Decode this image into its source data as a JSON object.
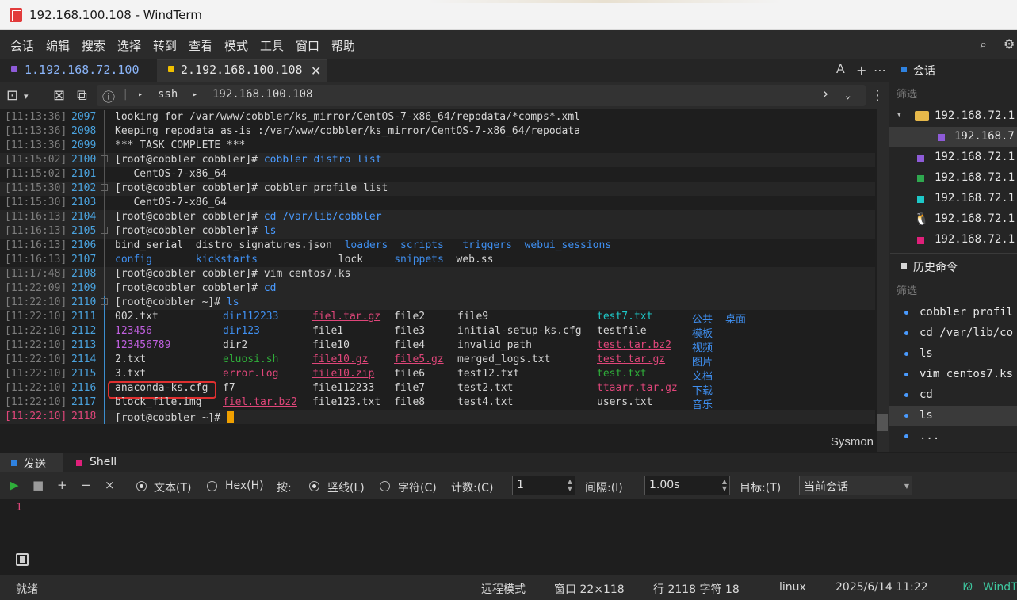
{
  "window": {
    "title": "192.168.100.108 - WindTerm"
  },
  "menu": [
    "会话",
    "编辑",
    "搜索",
    "选择",
    "转到",
    "查看",
    "模式",
    "工具",
    "窗口",
    "帮助"
  ],
  "menu_right_icons": [
    "search-icon",
    "settings-icon"
  ],
  "tabs": [
    {
      "label": "1.192.168.72.100",
      "color": "#8e5bd8",
      "active": false
    },
    {
      "label": "2.192.168.100.108",
      "color": "#f0c000",
      "active": true,
      "close": "✕"
    }
  ],
  "tab_right": {
    "font": "A",
    "add": "+",
    "more": "⋯"
  },
  "address": {
    "info_icon": "ⓘ",
    "proto": "ssh",
    "host": "192.168.100.108"
  },
  "terminal": {
    "lines": [
      {
        "ts": "[11:13:36]",
        "n": "2097",
        "segs": [
          {
            "t": "looking for /var/www/cobbler/ks_mirror/CentOS-7-x86_64/repodata/",
            "c": "white"
          },
          {
            "t": "*",
            "c": "white"
          },
          {
            "t": "comps",
            "c": "white"
          },
          {
            "t": "*",
            "c": "white"
          },
          {
            "t": ".xml",
            "c": "white"
          }
        ]
      },
      {
        "ts": "[11:13:36]",
        "n": "2098",
        "segs": [
          {
            "t": "Keeping repodata as-is :/var/www/cobbler/ks_mirror/CentOS-7-x86_64/repodata",
            "c": "white"
          }
        ]
      },
      {
        "ts": "[11:13:36]",
        "n": "2099",
        "segs": [
          {
            "t": "*** TASK COMPLETE ***",
            "c": "white"
          }
        ]
      },
      {
        "ts": "[11:15:02]",
        "n": "2100",
        "prompt": true,
        "segs": [
          {
            "t": "[root@cobbler cobbler]# ",
            "c": "white"
          },
          {
            "t": "cobbler distro list",
            "c": "blue2"
          }
        ]
      },
      {
        "ts": "[11:15:02]",
        "n": "2101",
        "segs": [
          {
            "t": "   CentOS-7-x86_64",
            "c": "white"
          }
        ]
      },
      {
        "ts": "[11:15:30]",
        "n": "2102",
        "prompt": true,
        "segs": [
          {
            "t": "[root@cobbler cobbler]# ",
            "c": "white"
          },
          {
            "t": "cobbler profile list",
            "c": "white"
          }
        ]
      },
      {
        "ts": "[11:15:30]",
        "n": "2103",
        "segs": [
          {
            "t": "   CentOS-7-x86_64",
            "c": "white"
          }
        ]
      },
      {
        "ts": "[11:16:13]",
        "n": "2104",
        "prompt": true,
        "segs": [
          {
            "t": "[root@cobbler cobbler]# ",
            "c": "white"
          },
          {
            "t": "cd /var/lib/cobbler",
            "c": "blue2"
          }
        ]
      },
      {
        "ts": "[11:16:13]",
        "n": "2105",
        "prompt": true,
        "segs": [
          {
            "t": "[root@cobbler cobbler]# ",
            "c": "white"
          },
          {
            "t": "ls",
            "c": "blue2"
          }
        ]
      },
      {
        "ts": "[11:16:13]",
        "n": "2106",
        "segs": [
          {
            "t": "bind_serial  distro_signatures.json  ",
            "c": "white"
          },
          {
            "t": "loaders  scripts   triggers  webui_sessions",
            "c": "blue"
          }
        ]
      },
      {
        "ts": "[11:16:13]",
        "n": "2107",
        "segs": [
          {
            "t": "config       kickstarts             ",
            "c": "blue"
          },
          {
            "t": "lock     ",
            "c": "white"
          },
          {
            "t": "snippets  ",
            "c": "blue"
          },
          {
            "t": "web.ss",
            "c": "white"
          }
        ]
      },
      {
        "ts": "[11:17:48]",
        "n": "2108",
        "prompt": true,
        "segs": [
          {
            "t": "[root@cobbler cobbler]# ",
            "c": "white"
          },
          {
            "t": "vim centos7.ks",
            "c": "white"
          }
        ]
      },
      {
        "ts": "[11:22:09]",
        "n": "2109",
        "prompt": true,
        "segs": [
          {
            "t": "[root@cobbler cobbler]# ",
            "c": "white"
          },
          {
            "t": "cd",
            "c": "blue2"
          }
        ]
      },
      {
        "ts": "[11:22:10]",
        "n": "2110",
        "prompt": true,
        "segs": [
          {
            "t": "[root@cobbler ~]# ",
            "c": "white"
          },
          {
            "t": "ls",
            "c": "blue2"
          }
        ]
      }
    ],
    "ls_rows": [
      {
        "ts": "[11:22:10]",
        "n": "2111",
        "cols": [
          {
            "t": "002.txt",
            "c": "white"
          },
          {
            "t": "dir112233",
            "c": "blue"
          },
          {
            "t": "fiel.tar.gz",
            "c": "red"
          },
          {
            "t": "file2",
            "c": "white"
          },
          {
            "t": "file9",
            "c": "white"
          },
          {
            "t": "test7.txt",
            "c": "cyan"
          },
          {
            "t": "公共",
            "c": "blue"
          },
          {
            "t": "桌面",
            "c": "blue"
          }
        ]
      },
      {
        "ts": "[11:22:10]",
        "n": "2112",
        "cols": [
          {
            "t": "123456",
            "c": "mag"
          },
          {
            "t": "dir123",
            "c": "blue"
          },
          {
            "t": "file1",
            "c": "white"
          },
          {
            "t": "file3",
            "c": "white"
          },
          {
            "t": "initial-setup-ks.cfg",
            "c": "white"
          },
          {
            "t": "testfile",
            "c": "white"
          },
          {
            "t": "模板",
            "c": "blue"
          },
          {
            "t": "",
            "c": "white"
          }
        ]
      },
      {
        "ts": "[11:22:10]",
        "n": "2113",
        "cols": [
          {
            "t": "123456789",
            "c": "mag"
          },
          {
            "t": "dir2",
            "c": "white"
          },
          {
            "t": "file10",
            "c": "white"
          },
          {
            "t": "file4",
            "c": "white"
          },
          {
            "t": "invalid_path",
            "c": "white"
          },
          {
            "t": "test.tar.bz2",
            "c": "red"
          },
          {
            "t": "视频",
            "c": "blue"
          },
          {
            "t": "",
            "c": "white"
          }
        ]
      },
      {
        "ts": "[11:22:10]",
        "n": "2114",
        "cols": [
          {
            "t": "2.txt",
            "c": "white"
          },
          {
            "t": "eluosi.sh",
            "c": "green"
          },
          {
            "t": "file10.gz",
            "c": "red"
          },
          {
            "t": "file5.gz",
            "c": "red"
          },
          {
            "t": "merged_logs.txt",
            "c": "white"
          },
          {
            "t": "test.tar.gz",
            "c": "red"
          },
          {
            "t": "图片",
            "c": "blue"
          },
          {
            "t": "",
            "c": "white"
          }
        ]
      },
      {
        "ts": "[11:22:10]",
        "n": "2115",
        "cols": [
          {
            "t": "3.txt",
            "c": "white"
          },
          {
            "t": "error.log",
            "c": "redplain"
          },
          {
            "t": "file10.zip",
            "c": "red"
          },
          {
            "t": "file6",
            "c": "white"
          },
          {
            "t": "test12.txt",
            "c": "white"
          },
          {
            "t": "test.txt",
            "c": "green"
          },
          {
            "t": "文档",
            "c": "blue"
          },
          {
            "t": "",
            "c": "white"
          }
        ]
      },
      {
        "ts": "[11:22:10]",
        "n": "2116",
        "cols": [
          {
            "t": "anaconda-ks.cfg",
            "c": "white"
          },
          {
            "t": "f7",
            "c": "white"
          },
          {
            "t": "file112233",
            "c": "white"
          },
          {
            "t": "file7",
            "c": "white"
          },
          {
            "t": "test2.txt",
            "c": "white"
          },
          {
            "t": "ttaarr.tar.gz",
            "c": "red"
          },
          {
            "t": "下载",
            "c": "blue"
          },
          {
            "t": "",
            "c": "white"
          }
        ]
      },
      {
        "ts": "[11:22:10]",
        "n": "2117",
        "cols": [
          {
            "t": "block_file.img",
            "c": "white"
          },
          {
            "t": "fiel.tar.bz2",
            "c": "red"
          },
          {
            "t": "file123.txt",
            "c": "white"
          },
          {
            "t": "file8",
            "c": "white"
          },
          {
            "t": "test4.txt",
            "c": "white"
          },
          {
            "t": "users.txt",
            "c": "white"
          },
          {
            "t": "音乐",
            "c": "blue"
          },
          {
            "t": "",
            "c": "white"
          }
        ]
      }
    ],
    "current": {
      "ts": "[11:22:10]",
      "n": "2118",
      "prompt": "[root@cobbler ~]# "
    },
    "sysmon": "Sysmon"
  },
  "right_panel": {
    "sessions_title": "会话",
    "filter": "筛选",
    "sessions": [
      {
        "label": "192.168.72.1",
        "type": "folder"
      },
      {
        "label": "192.168.7",
        "type": "child",
        "color": "#8e5bd8"
      },
      {
        "label": "192.168.72.1",
        "type": "item",
        "color": "#8e5bd8"
      },
      {
        "label": "192.168.72.1",
        "type": "item",
        "color": "#2fa84f"
      },
      {
        "label": "192.168.72.1",
        "type": "item",
        "color": "#1ec8c8"
      },
      {
        "label": "192.168.72.1",
        "type": "linux"
      },
      {
        "label": "192.168.72.1",
        "type": "item",
        "color": "#e0207a"
      }
    ],
    "history_title": "历史命令",
    "history_filter": "筛选",
    "history": [
      "cobbler profil",
      "cd /var/lib/co",
      "ls",
      "vim centos7.ks",
      "cd",
      "ls",
      "..."
    ]
  },
  "send_panel": {
    "tabs": [
      {
        "label": "发送",
        "color": "#2f82e0"
      },
      {
        "label": "Shell",
        "color": "#e0207a"
      }
    ],
    "text_mode": "文本(T)",
    "hex_mode": "Hex(H)",
    "by": "按:",
    "vline": "竖线(L)",
    "char": "字符(C)",
    "count_label": "计数:(C)",
    "count_value": "1",
    "interval_label": "间隔:(I)",
    "interval_value": "1.00s",
    "target_label": "目标:(T)",
    "target_value": "当前会话",
    "line_no": "1"
  },
  "status": {
    "ready": "就绪",
    "mode": "远程模式",
    "window": "窗口 22×118",
    "position": "行 2118 字符 18",
    "os": "linux",
    "datetime": "2025/6/14 11:22",
    "brand": "WindT"
  }
}
